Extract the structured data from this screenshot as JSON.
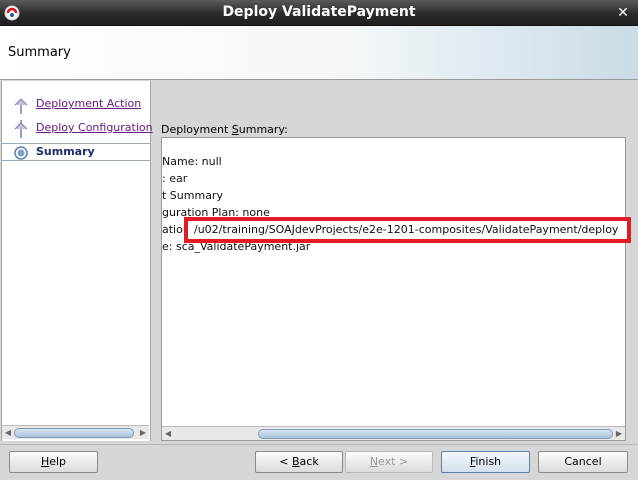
{
  "window": {
    "title": "Deploy ValidatePayment",
    "close_glyph": "✕"
  },
  "header": {
    "title": "Summary"
  },
  "nav": {
    "items": [
      {
        "label": "Deployment Action",
        "state": "visited"
      },
      {
        "label": "Deploy Configuration",
        "state": "visited"
      },
      {
        "label": "Summary",
        "state": "current"
      }
    ]
  },
  "content": {
    "label_pre": "Deployment ",
    "label_mnemonic": "S",
    "label_post": "ummary:",
    "lines": [
      "Name: null",
      ": ear",
      "t Summary",
      "guration Plan: none",
      "ation",
      "e: sca_ValidatePayment.jar"
    ],
    "highlighted_path": "/u02/training/SOAJdevProjects/e2e-1201-composites/ValidatePayment/deploy"
  },
  "buttons": {
    "help_mnemonic": "H",
    "help_rest": "elp",
    "back_pre": "< ",
    "back_mnemonic": "B",
    "back_rest": "ack",
    "next_mnemonic": "N",
    "next_rest": "ext >",
    "finish_mnemonic": "F",
    "finish_rest": "inish",
    "cancel": "Cancel"
  },
  "scroll_arrows": {
    "left": "◀",
    "right": "▶"
  },
  "colors": {
    "highlight": "#e01b24",
    "link": "#6a1a8a",
    "active_nav": "#1a2a6a"
  },
  "icons": {
    "app": "oracle-jdeveloper-icon",
    "step_visited": "step-done-icon",
    "step_current": "step-current-icon"
  }
}
